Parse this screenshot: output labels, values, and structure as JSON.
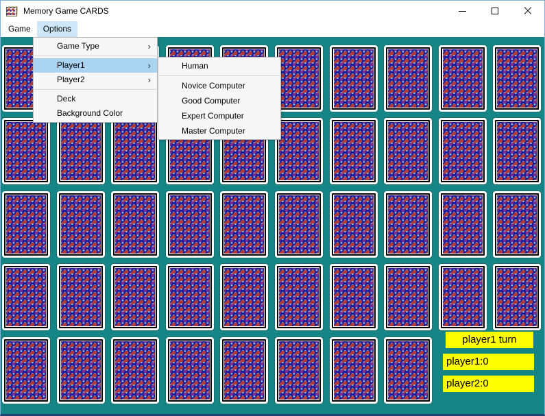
{
  "window": {
    "title": "Memory Game CARDS"
  },
  "menubar": {
    "items": [
      {
        "label": "Game"
      },
      {
        "label": "Options"
      }
    ]
  },
  "options_menu": {
    "items": [
      {
        "label": "Game Type",
        "has_submenu": true
      },
      {
        "label": "Player1",
        "has_submenu": true,
        "highlighted": true
      },
      {
        "label": "Player2",
        "has_submenu": true
      },
      {
        "label": "Deck"
      },
      {
        "label": "Background Color"
      }
    ]
  },
  "player1_submenu": {
    "items": [
      {
        "label": "Human"
      },
      {
        "label": "Novice Computer"
      },
      {
        "label": "Good Computer"
      },
      {
        "label": "Expert Computer"
      },
      {
        "label": "Master Computer"
      }
    ]
  },
  "board": {
    "rows": 5,
    "cols": 10,
    "last_row_cols": 8,
    "total_cards": 48,
    "card_left_start": 2,
    "card_top_start": 65,
    "col_pitch": 79.6,
    "row_pitch": 106.4
  },
  "status": {
    "turn": "player1 turn",
    "player1": "player1:0",
    "player2": "player2:0"
  },
  "colors": {
    "background_teal": "#168585",
    "status_yellow": "#ffff00",
    "card_navy": "#1b1b9a",
    "card_red": "#b13a3a",
    "card_lightblue": "#8fd2f0",
    "menu_highlight_blue": "#abd4f2",
    "menubar_highlight_blue": "#cde7f8"
  }
}
